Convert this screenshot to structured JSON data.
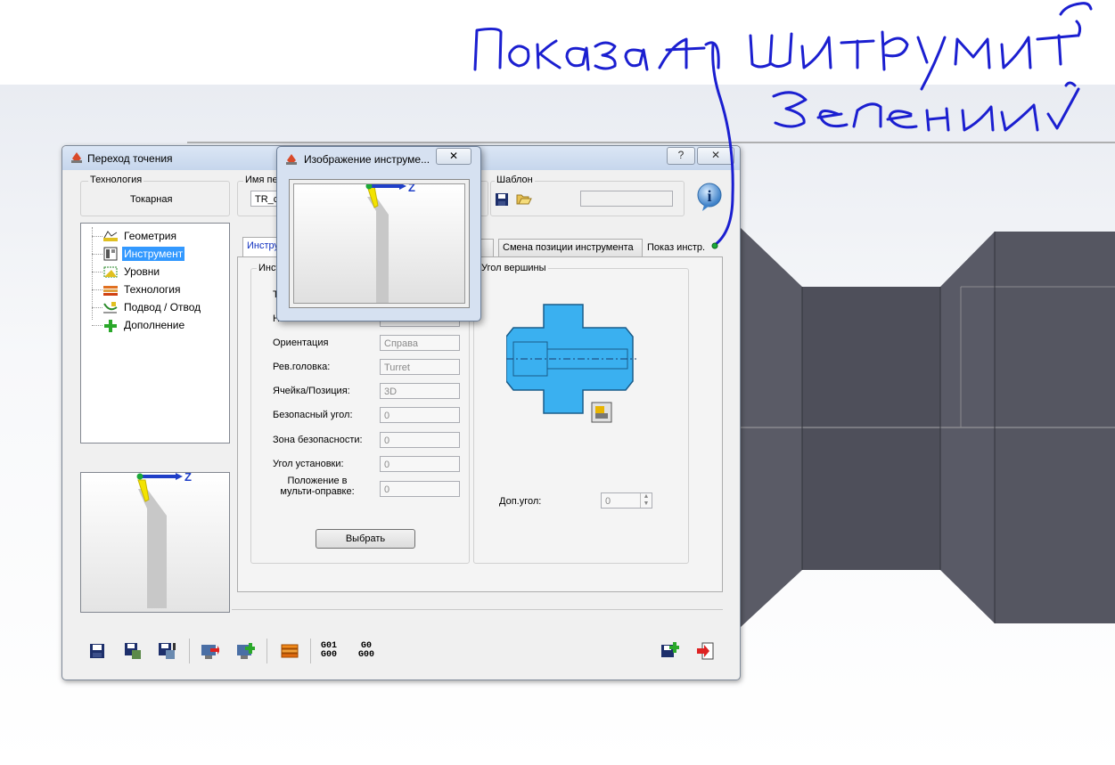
{
  "dialog": {
    "title": "Переход точения",
    "help_label": "?",
    "close_label": "✕",
    "technology_group": "Технология",
    "technology_value": "Токарная",
    "name_group": "Имя пер",
    "name_value": "TR_c",
    "template_group": "Шаблон",
    "template_value": ""
  },
  "tree": {
    "items": [
      {
        "label": "Геометрия",
        "icon": "geometry-icon"
      },
      {
        "label": "Инструмент",
        "icon": "tool-icon"
      },
      {
        "label": "Уровни",
        "icon": "levels-icon"
      },
      {
        "label": "Технология",
        "icon": "technology-icon"
      },
      {
        "label": "Подвод / Отвод",
        "icon": "approach-retract-icon"
      },
      {
        "label": "Дополнение",
        "icon": "addition-icon"
      }
    ],
    "selected_index": 1
  },
  "tabs": [
    {
      "label": "Инстру"
    },
    {
      "label": "ие"
    },
    {
      "label": "Смена позиции инструмента"
    },
    {
      "label": "Показ инстр."
    }
  ],
  "tool_panel": {
    "group_label": "Инст",
    "fields": [
      {
        "label": "Т",
        "value": ""
      },
      {
        "label": "Н",
        "value": ""
      },
      {
        "label": "Ориентация",
        "value": "Справа"
      },
      {
        "label": "Рев.головка:",
        "value": "Turret"
      },
      {
        "label": "Ячейка/Позиция:",
        "value": "3D"
      },
      {
        "label": "Безопасный угол:",
        "value": "0"
      },
      {
        "label": "Зона безопасности:",
        "value": "0"
      },
      {
        "label": "Угол установки:",
        "value": "0"
      },
      {
        "label": "Положение в мульти-оправке:",
        "value": "0"
      }
    ],
    "select_button": "Выбрать"
  },
  "vertex_panel": {
    "group_label": "Угол вершины",
    "extra_angle_label": "Доп.угол:",
    "extra_angle_value": "0"
  },
  "axis_label": "Z",
  "popup": {
    "title": "Изображение инструме...",
    "close_label": "✕"
  },
  "toolbar": {
    "g_code_a_top": "G01",
    "g_code_a_bottom": "G00",
    "g_code_b_top": "G0",
    "g_code_b_bottom": "G00"
  },
  "colors": {
    "part_blue": "#3ab0f0",
    "tool_yellow": "#f3e300",
    "axis_blue": "#1f3fc8",
    "handwriting": "#1b1fd0",
    "model_gray": "#54555f"
  }
}
